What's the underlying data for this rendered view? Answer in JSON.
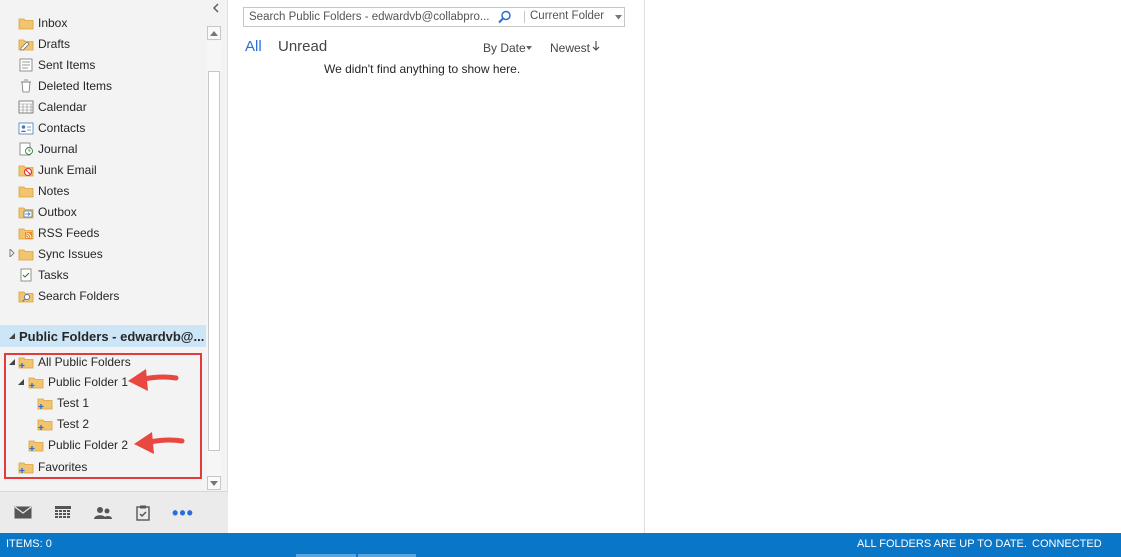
{
  "folders": {
    "items": [
      {
        "label": "Inbox",
        "icon": "inbox-folder-icon"
      },
      {
        "label": "Drafts",
        "icon": "drafts-folder-icon"
      },
      {
        "label": "Sent Items",
        "icon": "sent-items-icon"
      },
      {
        "label": "Deleted Items",
        "icon": "deleted-items-icon"
      },
      {
        "label": "Calendar",
        "icon": "calendar-icon"
      },
      {
        "label": "Contacts",
        "icon": "contacts-icon"
      },
      {
        "label": "Journal",
        "icon": "journal-icon"
      },
      {
        "label": "Junk Email",
        "icon": "junk-email-icon"
      },
      {
        "label": "Notes",
        "icon": "notes-folder-icon"
      },
      {
        "label": "Outbox",
        "icon": "outbox-icon"
      },
      {
        "label": "RSS Feeds",
        "icon": "rss-feeds-icon"
      },
      {
        "label": "Sync Issues",
        "icon": "sync-issues-folder-icon"
      },
      {
        "label": "Tasks",
        "icon": "tasks-icon"
      },
      {
        "label": "Search Folders",
        "icon": "search-folders-icon"
      }
    ]
  },
  "public_folders": {
    "header": "Public Folders - edwardvb@...",
    "items": [
      {
        "label": "All Public Folders"
      },
      {
        "label": "Public Folder 1"
      },
      {
        "label": "Test 1"
      },
      {
        "label": "Test 2"
      },
      {
        "label": "Public Folder 2"
      },
      {
        "label": "Favorites"
      }
    ]
  },
  "search": {
    "placeholder": "Search Public Folders - edwardvb@collabpro...",
    "scope": "Current Folder"
  },
  "list": {
    "tabs": [
      "All",
      "Unread"
    ],
    "sort_by": "By Date",
    "sort_order": "Newest",
    "empty_message": "We didn't find anything to show here."
  },
  "status": {
    "items": "ITEMS: 0",
    "sync": "ALL FOLDERS ARE UP TO DATE.",
    "connection": "CONNECTED"
  },
  "colors": {
    "accent": "#2a6fd6",
    "status_bar": "#0a76c8",
    "selected_header": "#cde6f7",
    "highlight": "#e33b3b",
    "folder": "#f2c46d"
  }
}
